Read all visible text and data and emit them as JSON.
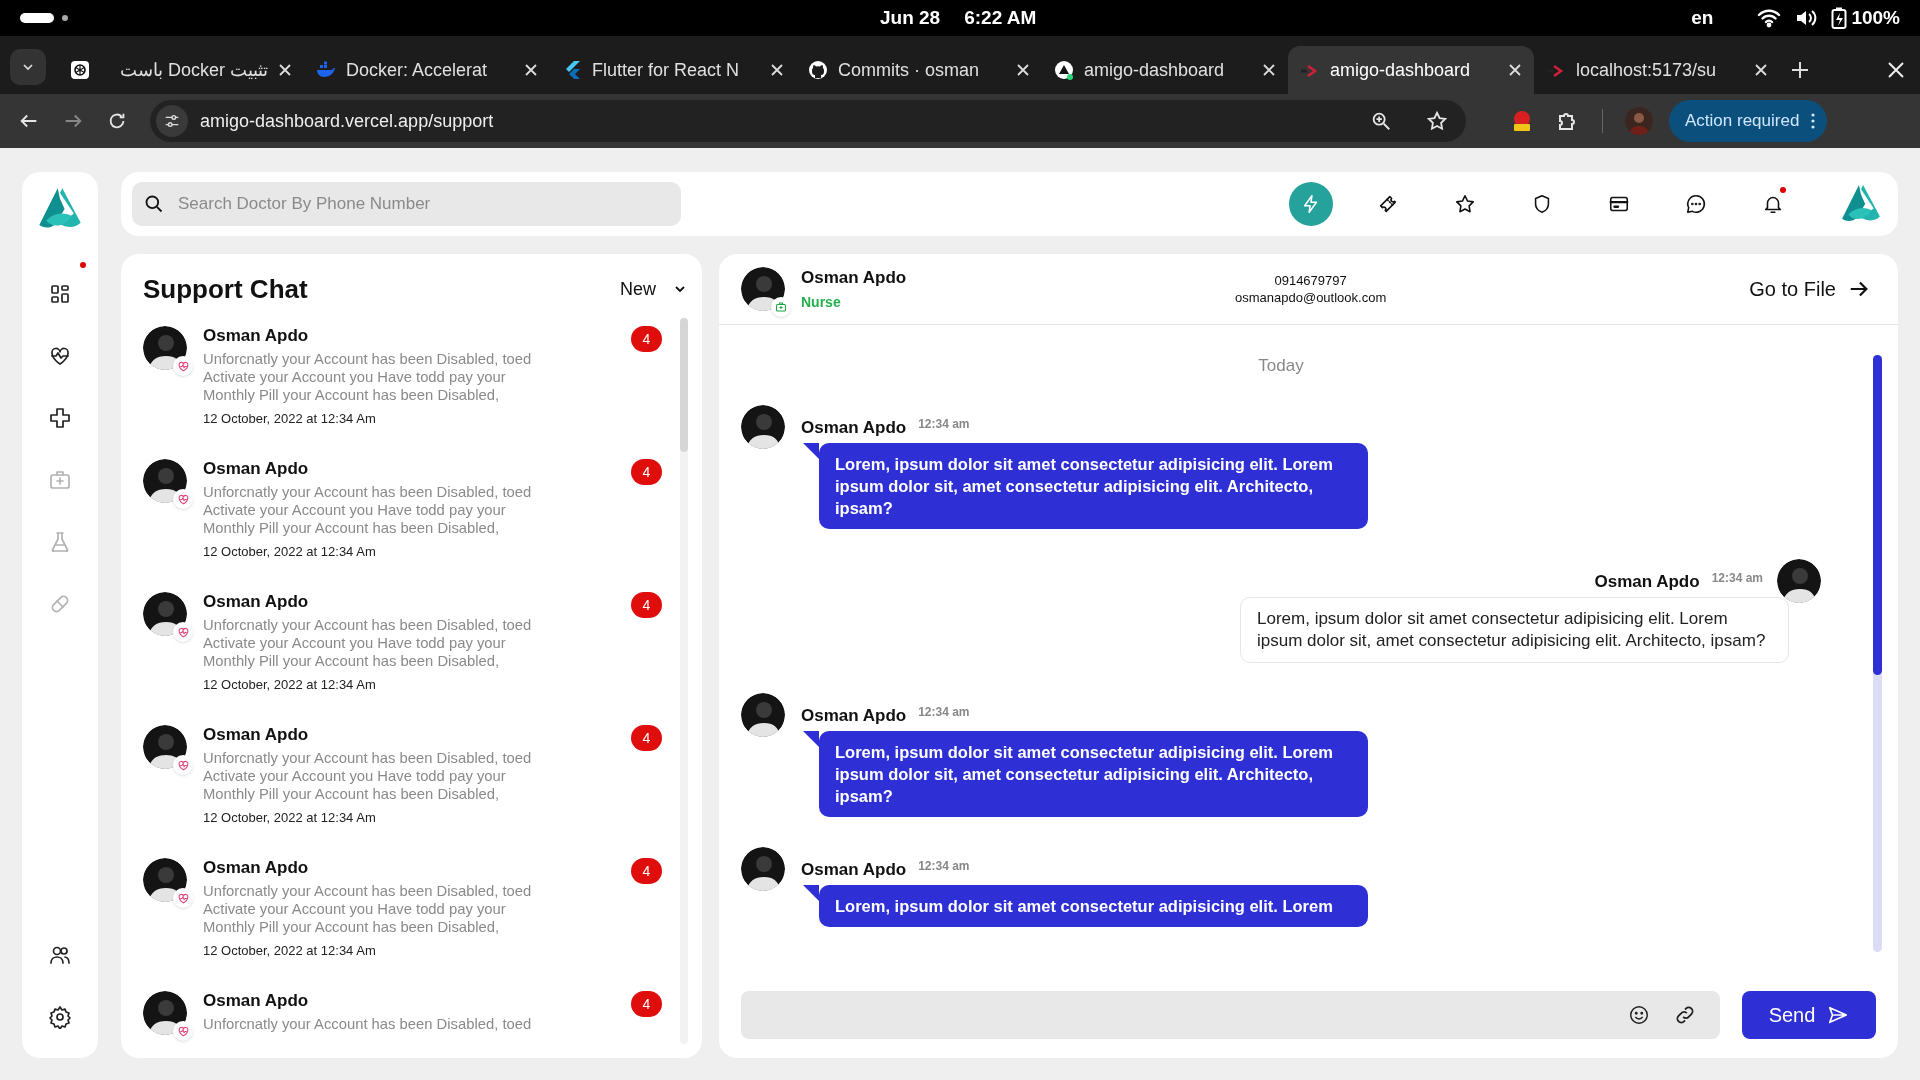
{
  "status_bar": {
    "date": "Jun 28",
    "time": "6:22 AM",
    "language": "en",
    "battery": "100%"
  },
  "tabs": [
    {
      "title": "تثبيت Docker باست",
      "kind": "knot",
      "selected": false
    },
    {
      "title": "Docker: Accelerat",
      "kind": "whale",
      "selected": false
    },
    {
      "title": "Flutter for React N",
      "kind": "chevron",
      "selected": false
    },
    {
      "title": "Commits · osman",
      "kind": "cat",
      "selected": false
    },
    {
      "title": "amigo-dashboard",
      "kind": "triangle",
      "selected": false
    },
    {
      "title": "amigo-dashboard",
      "kind": "arrow",
      "selected": true
    },
    {
      "title": "localhost:5173/su",
      "kind": "arrow",
      "selected": false
    }
  ],
  "address_bar": {
    "url": "amigo-dashboard.vercel.app/support",
    "action_button": "Action required"
  },
  "sidebar": {
    "items": [
      {
        "kind": "dashboard",
        "dimmed": false,
        "dot": true
      },
      {
        "kind": "heart-pulse",
        "dimmed": false,
        "dot": false
      },
      {
        "kind": "cross",
        "dimmed": false,
        "dot": false
      },
      {
        "kind": "medical-kit",
        "dimmed": true,
        "dot": false
      },
      {
        "kind": "flask",
        "dimmed": true,
        "dot": false
      },
      {
        "kind": "pill",
        "dimmed": true,
        "dot": false
      }
    ],
    "bottom_items": [
      {
        "kind": "users",
        "dimmed": false,
        "dot": false
      },
      {
        "kind": "settings",
        "dimmed": false,
        "dot": false
      }
    ]
  },
  "top_bar": {
    "search": {
      "placeholder": "Search Doctor By Phone Number"
    },
    "actions": [
      {
        "kind": "bolt",
        "selected": true,
        "dot": false
      },
      {
        "kind": "ticket",
        "selected": false,
        "dot": false
      },
      {
        "kind": "star",
        "selected": false,
        "dot": false
      },
      {
        "kind": "shield",
        "selected": false,
        "dot": false
      },
      {
        "kind": "card",
        "selected": false,
        "dot": false
      },
      {
        "kind": "chat",
        "selected": false,
        "dot": false
      },
      {
        "kind": "bell",
        "selected": false,
        "dot": true
      }
    ]
  },
  "chat_list": {
    "title": "Support Chat",
    "filter": "New",
    "items": [
      {
        "name": "Osman Apdo",
        "preview": "Unforcnatly your Account has been Disabled, toed Activate your Account you Have todd pay your Monthly Pill your Account has been Disabled,",
        "date": "12 October, 2022 at 12:34 Am",
        "unread": "4"
      },
      {
        "name": "Osman Apdo",
        "preview": "Unforcnatly your Account has been Disabled, toed Activate your Account you Have todd pay your Monthly Pill your Account has been Disabled,",
        "date": "12 October, 2022 at 12:34 Am",
        "unread": "4"
      },
      {
        "name": "Osman Apdo",
        "preview": "Unforcnatly your Account has been Disabled, toed Activate your Account you Have todd pay your Monthly Pill your Account has been Disabled,",
        "date": "12 October, 2022 at 12:34 Am",
        "unread": "4"
      },
      {
        "name": "Osman Apdo",
        "preview": "Unforcnatly your Account has been Disabled, toed Activate your Account you Have todd pay your Monthly Pill your Account has been Disabled,",
        "date": "12 October, 2022 at 12:34 Am",
        "unread": "4"
      },
      {
        "name": "Osman Apdo",
        "preview": "Unforcnatly your Account has been Disabled, toed Activate your Account you Have todd pay your Monthly Pill your Account has been Disabled,",
        "date": "12 October, 2022 at 12:34 Am",
        "unread": "4"
      },
      {
        "name": "Osman Apdo",
        "preview": "Unforcnatly your Account has been Disabled, toed",
        "unread": "4"
      }
    ]
  },
  "chat": {
    "contact": {
      "name": "Osman Apdo",
      "role": "Nurse",
      "phone": "0914679797",
      "email": "osmanapdo@outlook.com",
      "go_to_file": "Go to File"
    },
    "day_divider": "Today",
    "messages": [
      {
        "kind": "received",
        "name": "Osman Apdo",
        "time": "12:34 am",
        "text": "Lorem, ipsum dolor sit amet consectetur adipisicing elit. Lorem ipsum dolor sit, amet consectetur adipisicing elit. Architecto, ipsam?"
      },
      {
        "kind": "sent",
        "name": "Osman Apdo",
        "time": "12:34 am",
        "text": "Lorem, ipsum dolor sit amet consectetur adipisicing elit. Lorem ipsum dolor sit, amet consectetur adipisicing elit. Architecto, ipsam?"
      },
      {
        "kind": "received",
        "name": "Osman Apdo",
        "time": "12:34 am",
        "text": "Lorem, ipsum dolor sit amet consectetur adipisicing elit. Lorem ipsum dolor sit, amet consectetur adipisicing elit. Architecto, ipsam?"
      },
      {
        "kind": "received",
        "name": "Osman Apdo",
        "time": "12:34 am",
        "text": "Lorem, ipsum dolor sit amet consectetur adipisicing elit. Lorem"
      }
    ],
    "send_button": "Send"
  }
}
